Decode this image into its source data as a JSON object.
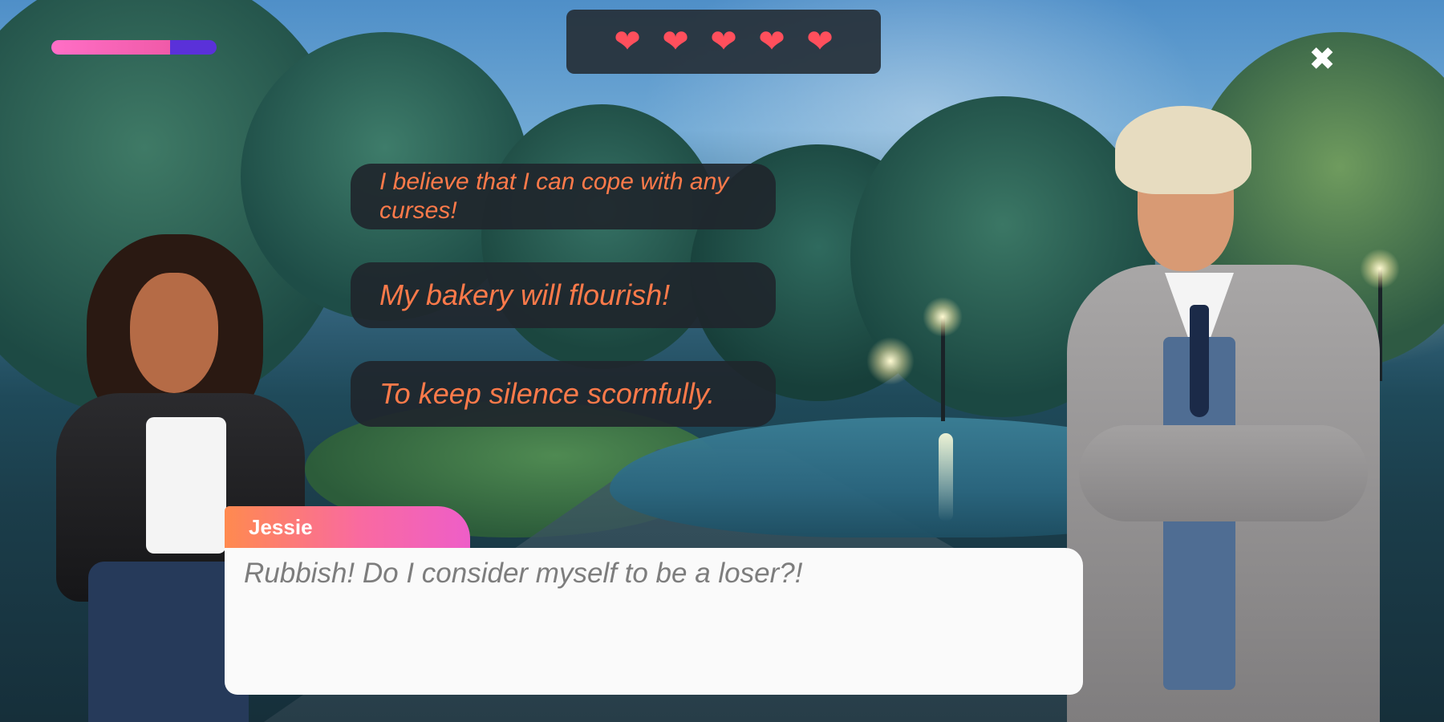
{
  "hud": {
    "progress": 0.72,
    "hearts": [
      "heart-1",
      "heart-2",
      "heart-3",
      "heart-4",
      "heart-5"
    ],
    "heart_glyph": "❤",
    "close_glyph": "✖",
    "colors": {
      "progress_fill": "#f05aa8",
      "progress_track": "#5a31d9",
      "heart": "#ff4f5c"
    }
  },
  "choices": [
    {
      "text": "I believe that I can cope with any curses!"
    },
    {
      "text": "My bakery will flourish!"
    },
    {
      "text": "To keep silence scornfully."
    }
  ],
  "dialogue": {
    "speaker": "Jessie",
    "text": "Rubbish! Do I consider myself to be a loser?!"
  },
  "colors": {
    "choice_text": "#ff7a4a",
    "choice_bg": "#20262c",
    "dialogue_text": "#7d7d7d"
  }
}
